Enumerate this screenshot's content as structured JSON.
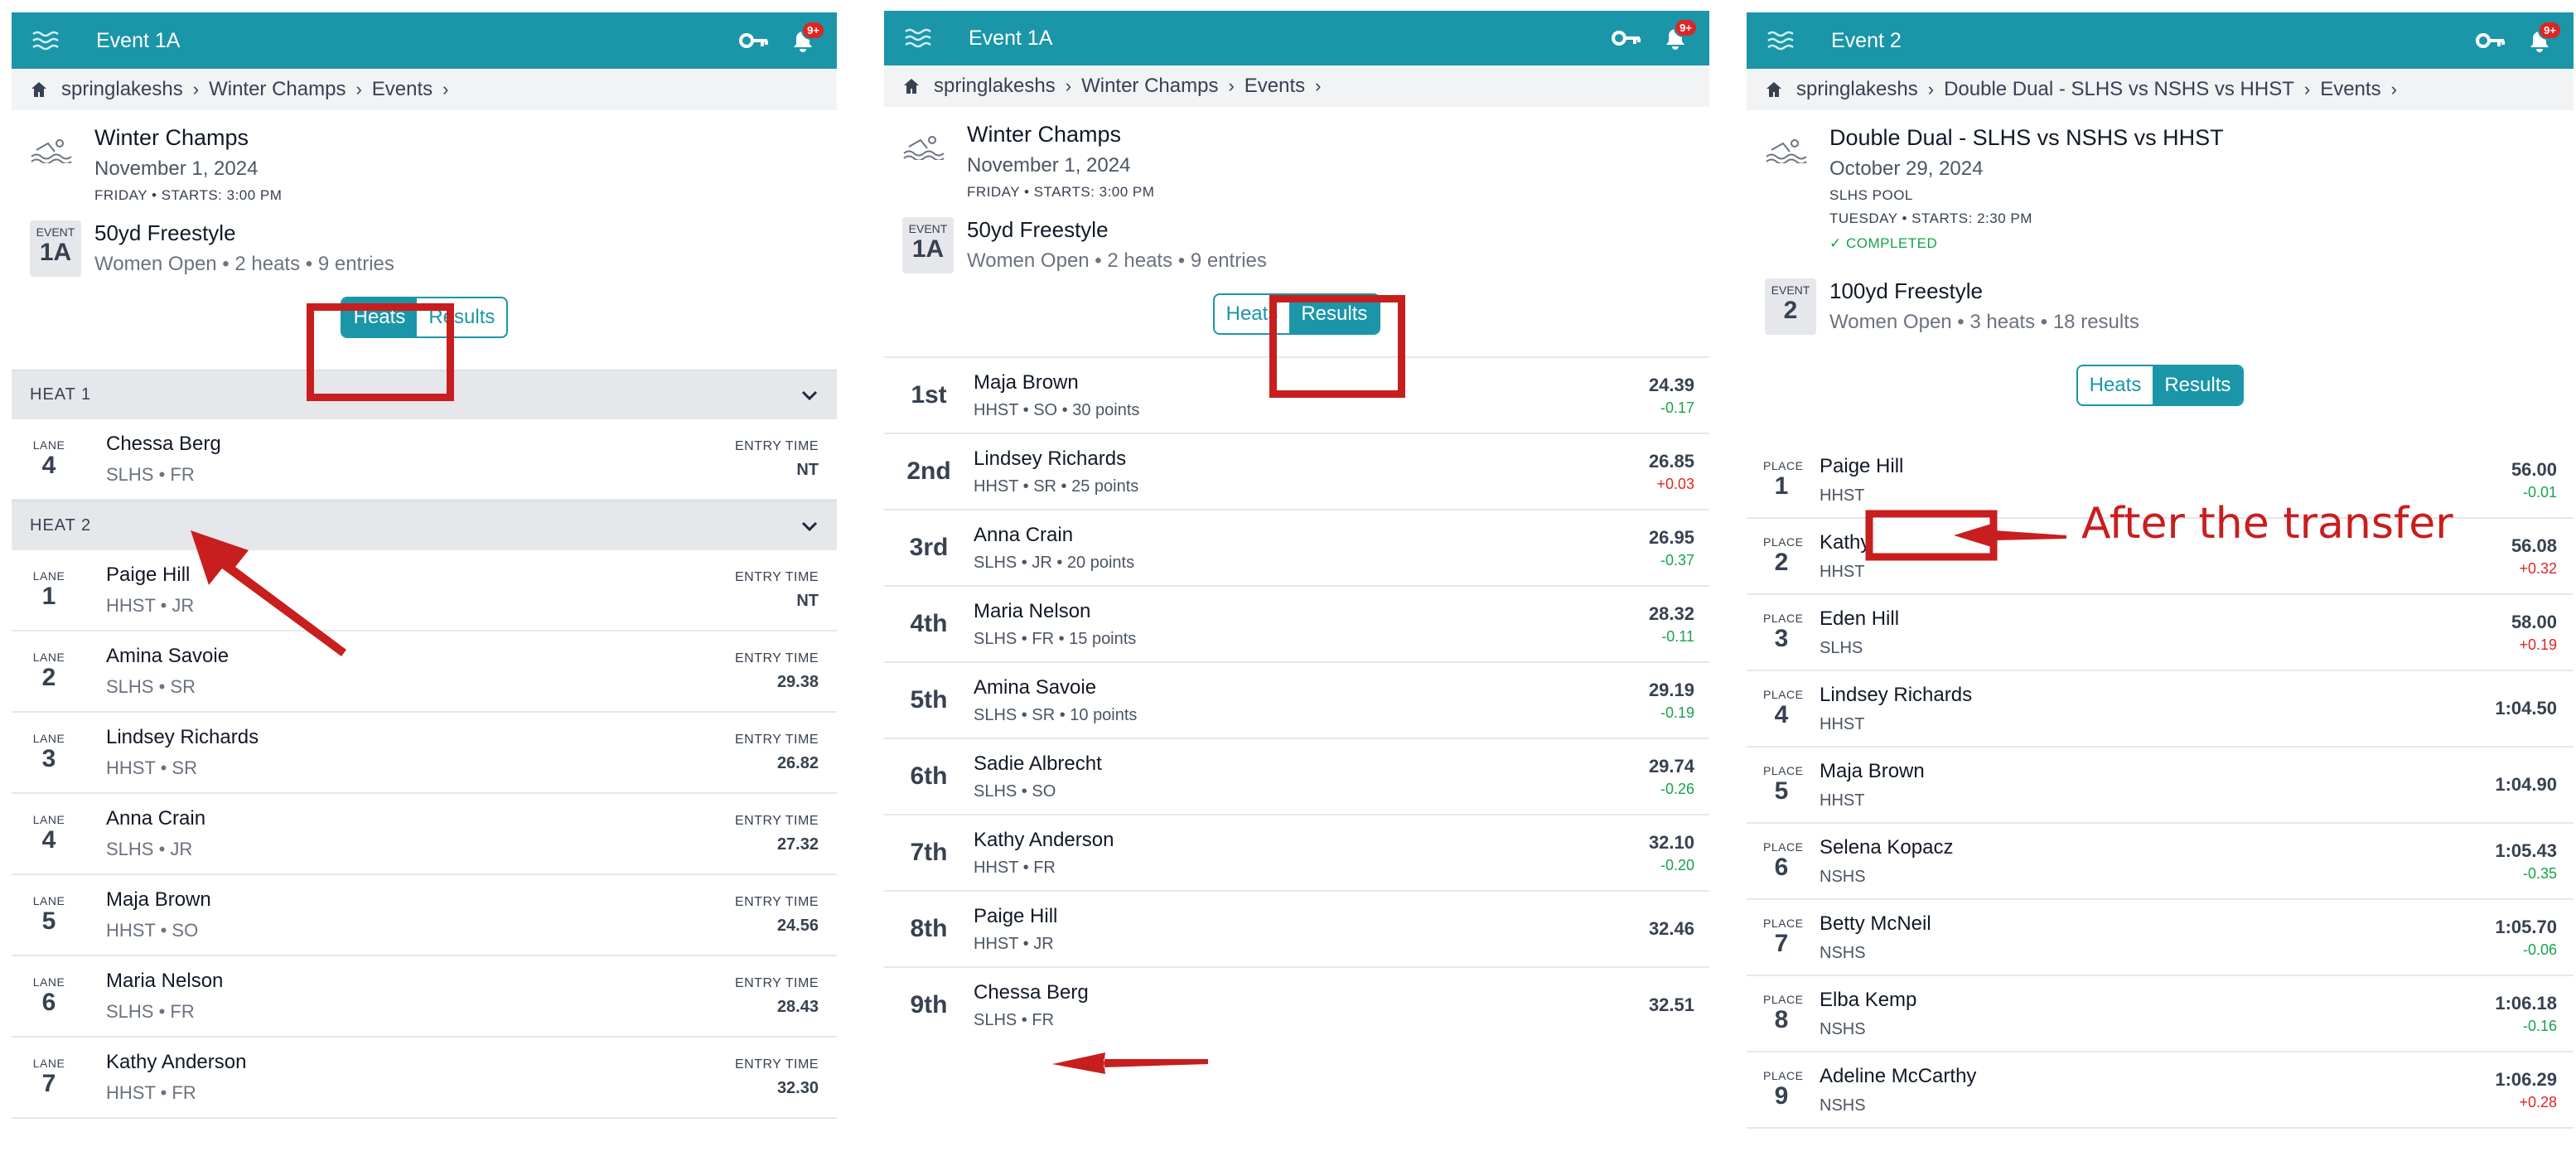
{
  "panel1": {
    "title": "Event 1A",
    "badge": "9+",
    "crumbs": [
      "springlakeshs",
      "Winter Champs",
      "Events"
    ],
    "meet_name": "Winter Champs",
    "meet_date": "November 1, 2024",
    "meet_day": "FRIDAY",
    "meet_start": "STARTS: 3:00 PM",
    "event_label": "EVENT",
    "event_num": "1A",
    "event_name": "50yd Freestyle",
    "event_sub": "Women Open • 2 heats • 9 entries",
    "tab_heats": "Heats",
    "tab_results": "Results",
    "lane_label": "LANE",
    "entry_label": "ENTRY TIME",
    "heats": [
      {
        "title": "HEAT 1",
        "rows": [
          {
            "lane": "4",
            "name": "Chessa Berg",
            "team": "SLHS  •  FR",
            "entry": "NT"
          }
        ]
      },
      {
        "title": "HEAT 2",
        "rows": [
          {
            "lane": "1",
            "name": "Paige Hill",
            "team": "HHST  •  JR",
            "entry": "NT"
          },
          {
            "lane": "2",
            "name": "Amina Savoie",
            "team": "SLHS  •  SR",
            "entry": "29.38"
          },
          {
            "lane": "3",
            "name": "Lindsey Richards",
            "team": "HHST  •  SR",
            "entry": "26.82"
          },
          {
            "lane": "4",
            "name": "Anna Crain",
            "team": "SLHS  •  JR",
            "entry": "27.32"
          },
          {
            "lane": "5",
            "name": "Maja Brown",
            "team": "HHST  •  SO",
            "entry": "24.56"
          },
          {
            "lane": "6",
            "name": "Maria Nelson",
            "team": "SLHS  •  FR",
            "entry": "28.43"
          },
          {
            "lane": "7",
            "name": "Kathy Anderson",
            "team": "HHST  •  FR",
            "entry": "32.30"
          }
        ]
      }
    ]
  },
  "panel2": {
    "title": "Event 1A",
    "badge": "9+",
    "crumbs": [
      "springlakeshs",
      "Winter Champs",
      "Events"
    ],
    "meet_name": "Winter Champs",
    "meet_date": "November 1, 2024",
    "meet_day": "FRIDAY",
    "meet_start": "STARTS: 3:00 PM",
    "event_label": "EVENT",
    "event_num": "1A",
    "event_name": "50yd Freestyle",
    "event_sub": "Women Open • 2 heats • 9 entries",
    "tab_heats": "Heats",
    "tab_results": "Results",
    "results": [
      {
        "place": "1st",
        "name": "Maja Brown",
        "sub": "HHST • SO • 30 points",
        "time": "24.39",
        "diff": "-0.17",
        "dir": "neg"
      },
      {
        "place": "2nd",
        "name": "Lindsey Richards",
        "sub": "HHST • SR • 25 points",
        "time": "26.85",
        "diff": "+0.03",
        "dir": "pos"
      },
      {
        "place": "3rd",
        "name": "Anna Crain",
        "sub": "SLHS • JR • 20 points",
        "time": "26.95",
        "diff": "-0.37",
        "dir": "neg"
      },
      {
        "place": "4th",
        "name": "Maria Nelson",
        "sub": "SLHS • FR • 15 points",
        "time": "28.32",
        "diff": "-0.11",
        "dir": "neg"
      },
      {
        "place": "5th",
        "name": "Amina Savoie",
        "sub": "SLHS • SR • 10 points",
        "time": "29.19",
        "diff": "-0.19",
        "dir": "neg"
      },
      {
        "place": "6th",
        "name": "Sadie Albrecht",
        "sub": "SLHS • SO",
        "time": "29.74",
        "diff": "-0.26",
        "dir": "neg"
      },
      {
        "place": "7th",
        "name": "Kathy Anderson",
        "sub": "HHST • FR",
        "time": "32.10",
        "diff": "-0.20",
        "dir": "neg"
      },
      {
        "place": "8th",
        "name": "Paige Hill",
        "sub": "HHST • JR",
        "time": "32.46",
        "diff": "",
        "dir": ""
      },
      {
        "place": "9th",
        "name": "Chessa Berg",
        "sub": "SLHS • FR",
        "time": "32.51",
        "diff": "",
        "dir": ""
      }
    ]
  },
  "panel3": {
    "title": "Event 2",
    "badge": "9+",
    "crumbs": [
      "springlakeshs",
      "Double Dual - SLHS vs NSHS vs HHST",
      "Events"
    ],
    "meet_name": "Double Dual - SLHS vs NSHS vs HHST",
    "meet_date": "October 29, 2024",
    "meet_venue": "SLHS POOL",
    "meet_day": "TUESDAY",
    "meet_start": "STARTS: 2:30 PM",
    "meet_status": "COMPLETED",
    "event_label": "EVENT",
    "event_num": "2",
    "event_name": "100yd Freestyle",
    "event_sub": "Women Open • 3 heats • 18 results",
    "tab_heats": "Heats",
    "tab_results": "Results",
    "place_label": "PLACE",
    "results": [
      {
        "place": "1",
        "name": "Paige Hill",
        "sub": "HHST",
        "time": "56.00",
        "diff": "-0.01",
        "dir": "neg"
      },
      {
        "place": "2",
        "name": "Kathy Anderson",
        "sub": "HHST",
        "time": "56.08",
        "diff": "+0.32",
        "dir": "pos"
      },
      {
        "place": "3",
        "name": "Eden Hill",
        "sub": "SLHS",
        "time": "58.00",
        "diff": "+0.19",
        "dir": "pos"
      },
      {
        "place": "4",
        "name": "Lindsey Richards",
        "sub": "HHST",
        "time": "1:04.50",
        "diff": "",
        "dir": ""
      },
      {
        "place": "5",
        "name": "Maja Brown",
        "sub": "HHST",
        "time": "1:04.90",
        "diff": "",
        "dir": ""
      },
      {
        "place": "6",
        "name": "Selena Kopacz",
        "sub": "NSHS",
        "time": "1:05.43",
        "diff": "-0.35",
        "dir": "neg"
      },
      {
        "place": "7",
        "name": "Betty McNeil",
        "sub": "NSHS",
        "time": "1:05.70",
        "diff": "-0.06",
        "dir": "neg"
      },
      {
        "place": "8",
        "name": "Elba Kemp",
        "sub": "NSHS",
        "time": "1:06.18",
        "diff": "-0.16",
        "dir": "neg"
      },
      {
        "place": "9",
        "name": "Adeline McCarthy",
        "sub": "NSHS",
        "time": "1:06.29",
        "diff": "+0.28",
        "dir": "pos"
      }
    ]
  },
  "annotation": "After the transfer",
  "colors": {
    "accent": "#1a96a8",
    "annotation": "#c81e1e",
    "faster": "#16a34a",
    "slower": "#dc2626"
  }
}
